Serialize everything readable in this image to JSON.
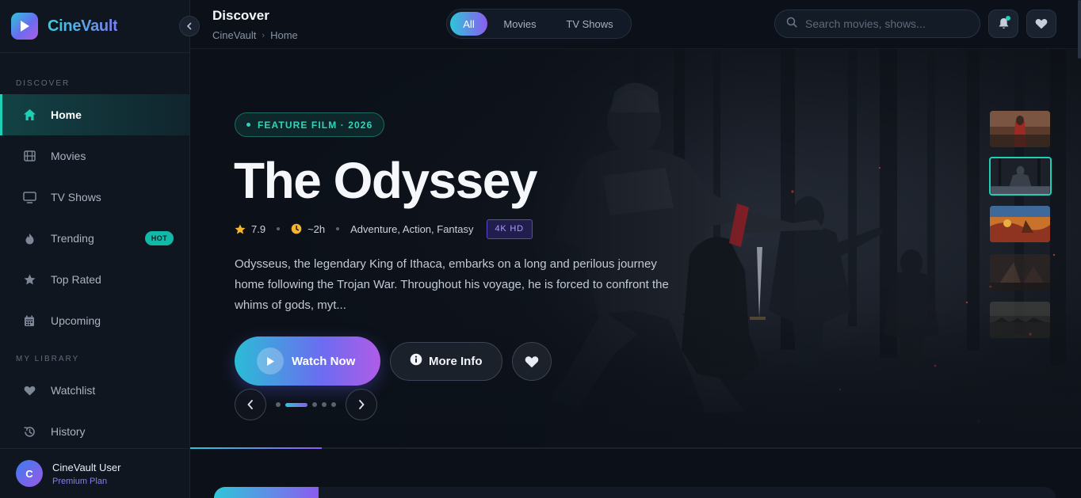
{
  "app": {
    "name": "CineVault"
  },
  "sidebar": {
    "sections": [
      {
        "label": "DISCOVER"
      },
      {
        "label": "MY LIBRARY"
      }
    ],
    "items": [
      {
        "label": "Home",
        "icon": "home-icon",
        "active": true
      },
      {
        "label": "Movies",
        "icon": "film-icon"
      },
      {
        "label": "TV Shows",
        "icon": "tv-icon"
      },
      {
        "label": "Trending",
        "icon": "flame-icon",
        "badge": "HOT"
      },
      {
        "label": "Top Rated",
        "icon": "star-icon"
      },
      {
        "label": "Upcoming",
        "icon": "calendar-icon"
      },
      {
        "label": "Watchlist",
        "icon": "heart-icon"
      },
      {
        "label": "History",
        "icon": "history-icon"
      }
    ],
    "user": {
      "initial": "C",
      "name": "CineVault User",
      "plan": "Premium Plan"
    }
  },
  "header": {
    "title": "Discover",
    "breadcrumb": [
      "CineVault",
      "Home"
    ],
    "breadcrumb_separator": "›",
    "filters": [
      {
        "label": "All",
        "active": true
      },
      {
        "label": "Movies"
      },
      {
        "label": "TV Shows"
      }
    ],
    "search": {
      "placeholder": "Search movies, shows..."
    }
  },
  "hero": {
    "tag": "FEATURE FILM · 2026",
    "title": "The Odyssey",
    "rating": "7.9",
    "duration": "~2h",
    "genres": "Adventure, Action, Fantasy",
    "quality": "4K HD",
    "description": "Odysseus, the legendary King of Ithaca, embarks on a long and perilous journey home following the Trojan War. Throughout his voyage, he is forced to confront the whims of gods, myt...",
    "watch_label": "Watch Now",
    "info_label": "More Info",
    "slides_total": 5,
    "active_slide": 2,
    "progress_fraction": 0.148
  },
  "colors": {
    "accent_teal": "#1ed0b4",
    "accent_cyan": "#2ec5d8",
    "accent_purple": "#8b5cf0",
    "background": "#0c1119"
  }
}
